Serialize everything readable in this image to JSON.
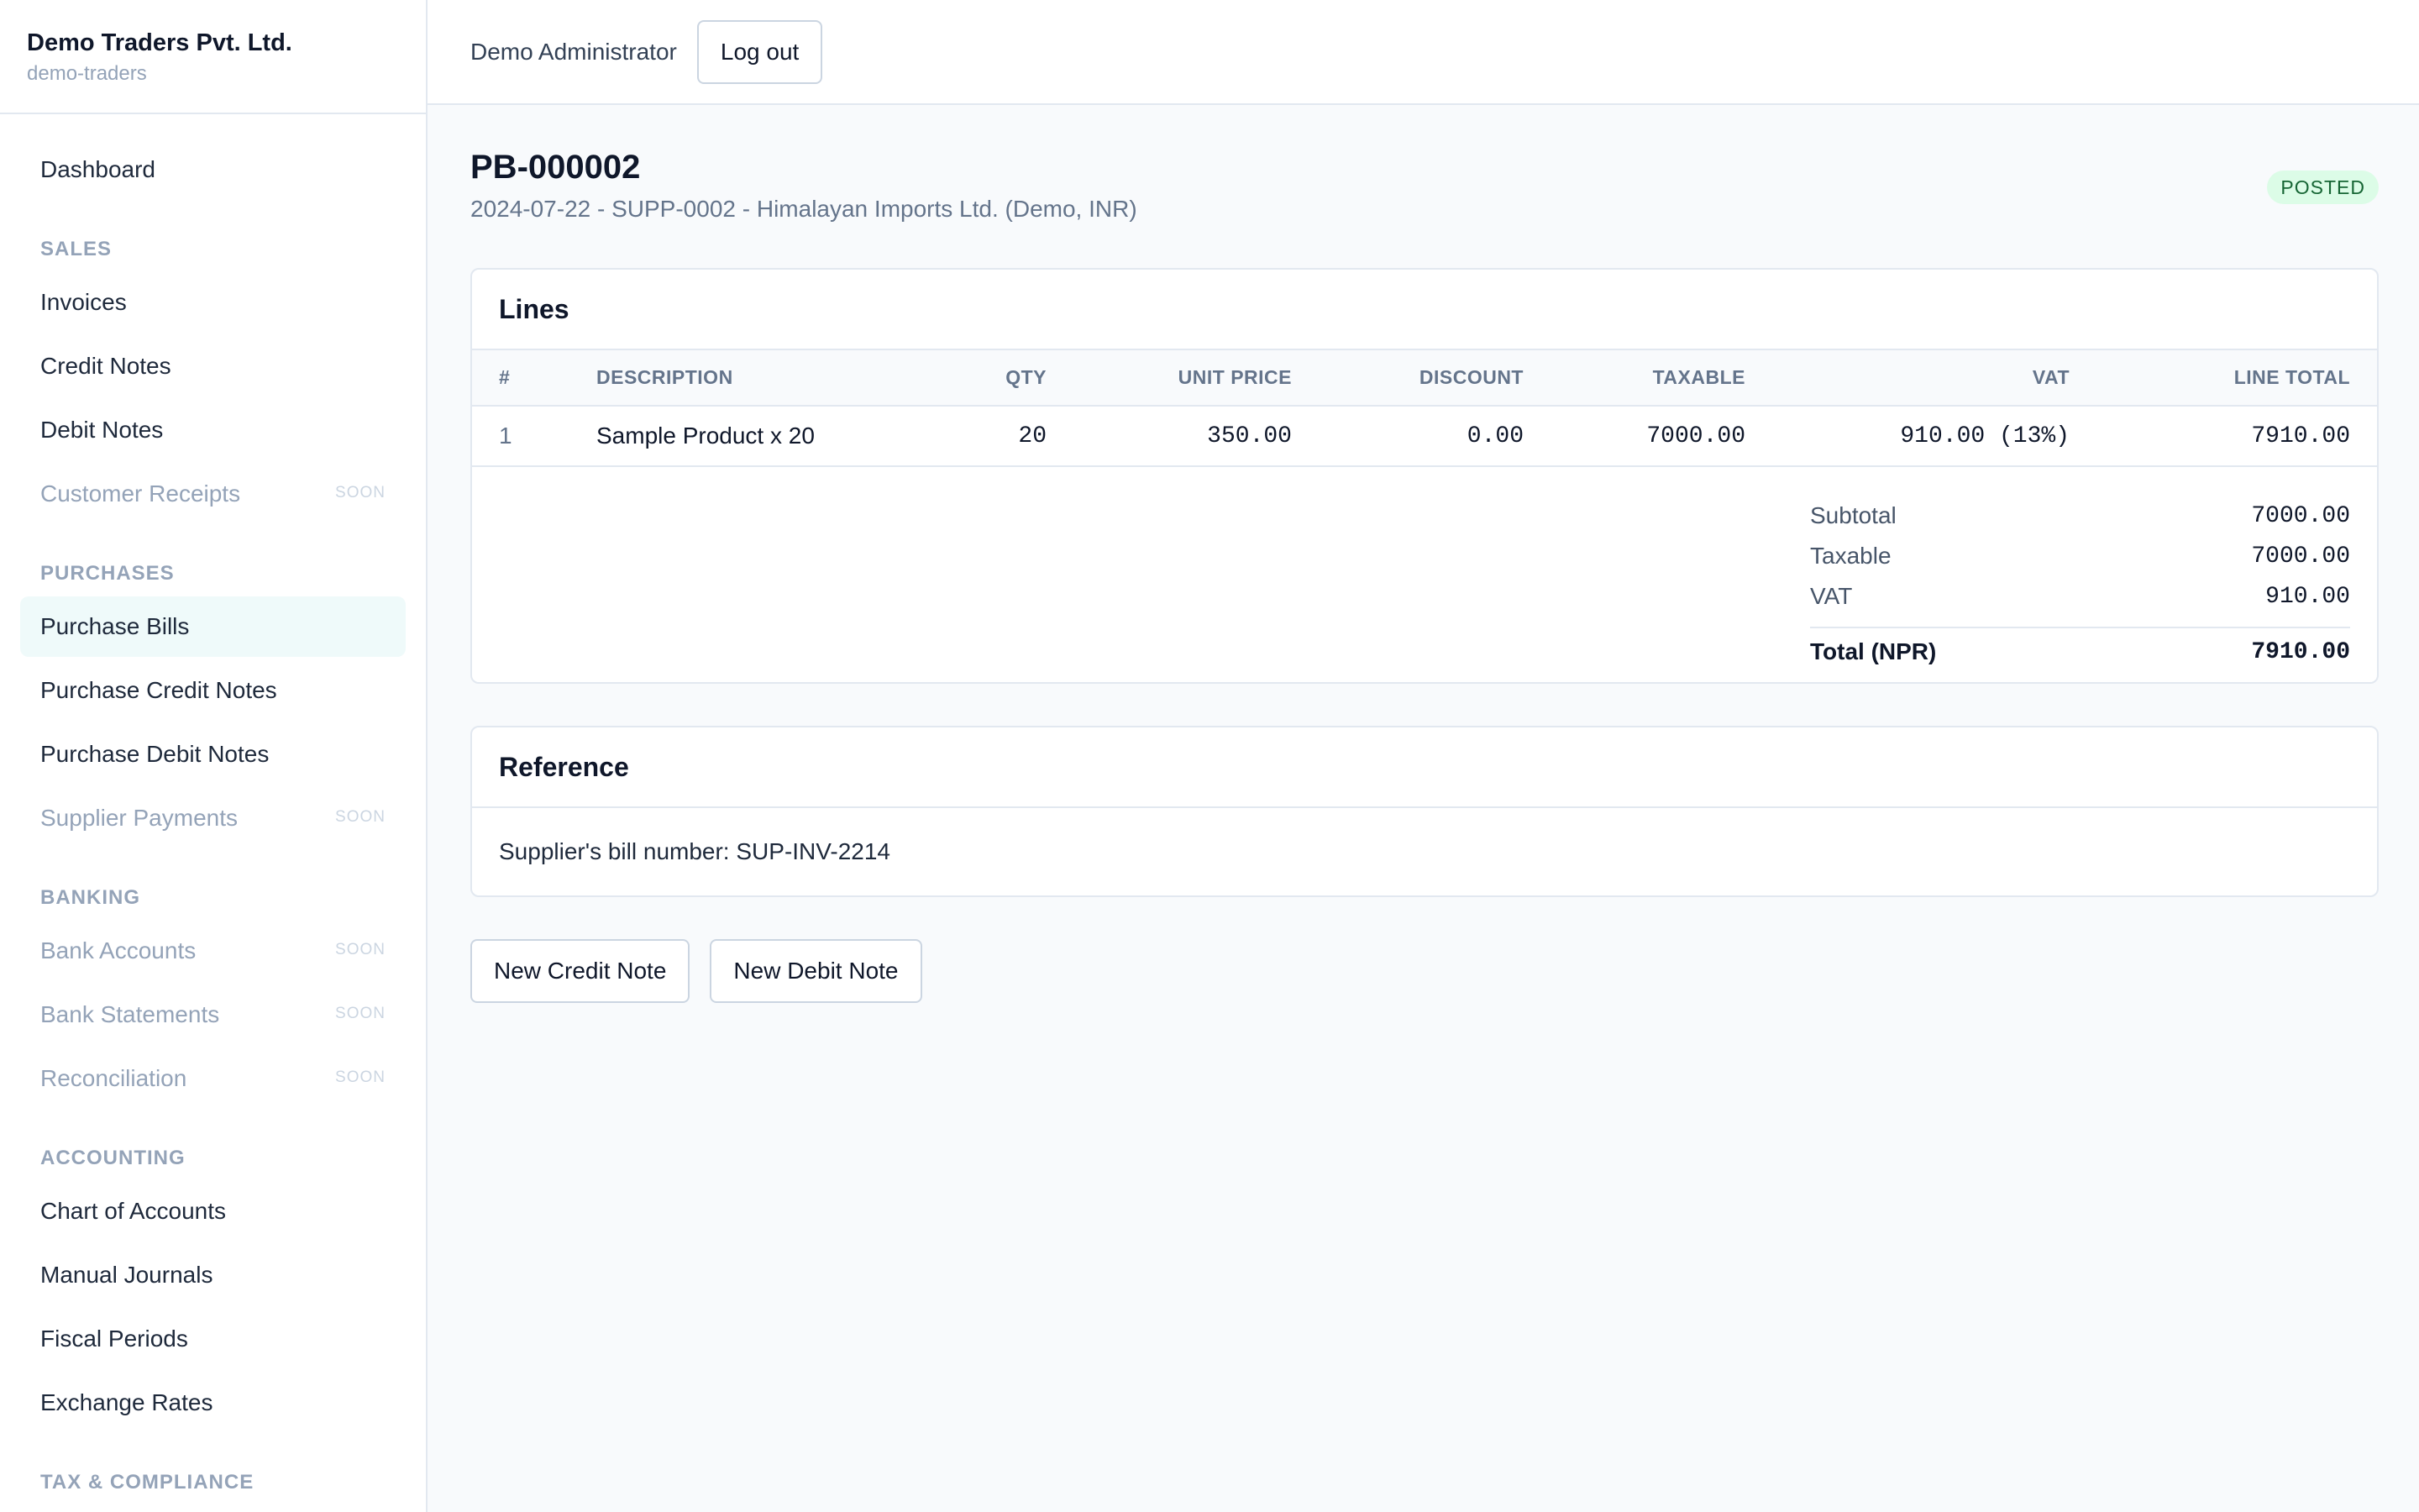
{
  "org": {
    "name": "Demo Traders Pvt. Ltd.",
    "slug": "demo-traders"
  },
  "sidebar": {
    "soon_label": "SOON",
    "dashboard": "Dashboard",
    "sections": {
      "sales": {
        "title": "SALES",
        "items": [
          "Invoices",
          "Credit Notes",
          "Debit Notes",
          "Customer Receipts"
        ]
      },
      "purchases": {
        "title": "PURCHASES",
        "items": [
          "Purchase Bills",
          "Purchase Credit Notes",
          "Purchase Debit Notes",
          "Supplier Payments"
        ]
      },
      "banking": {
        "title": "BANKING",
        "items": [
          "Bank Accounts",
          "Bank Statements",
          "Reconciliation"
        ]
      },
      "accounting": {
        "title": "ACCOUNTING",
        "items": [
          "Chart of Accounts",
          "Manual Journals",
          "Fiscal Periods",
          "Exchange Rates"
        ]
      },
      "tax": {
        "title": "TAX & COMPLIANCE"
      }
    }
  },
  "topbar": {
    "user": "Demo Administrator",
    "logout_label": "Log out"
  },
  "bill": {
    "number": "PB-000002",
    "subtitle": "2024-07-22 - SUPP-0002 - Himalayan Imports Ltd. (Demo, INR)",
    "status": "POSTED"
  },
  "lines_card": {
    "title": "Lines",
    "columns": [
      "#",
      "DESCRIPTION",
      "QTY",
      "UNIT PRICE",
      "DISCOUNT",
      "TAXABLE",
      "VAT",
      "LINE TOTAL"
    ],
    "rows": [
      {
        "num": "1",
        "description": "Sample Product x 20",
        "qty": "20",
        "unit_price": "350.00",
        "discount": "0.00",
        "taxable": "7000.00",
        "vat": "910.00 (13%)",
        "line_total": "7910.00"
      }
    ]
  },
  "totals": {
    "subtotal_label": "Subtotal",
    "subtotal": "7000.00",
    "taxable_label": "Taxable",
    "taxable": "7000.00",
    "vat_label": "VAT",
    "vat": "910.00",
    "total_label": "Total (NPR)",
    "total": "7910.00"
  },
  "reference": {
    "title": "Reference",
    "text": "Supplier's bill number: SUP-INV-2214"
  },
  "actions": {
    "new_credit_note": "New Credit Note",
    "new_debit_note": "New Debit Note"
  }
}
